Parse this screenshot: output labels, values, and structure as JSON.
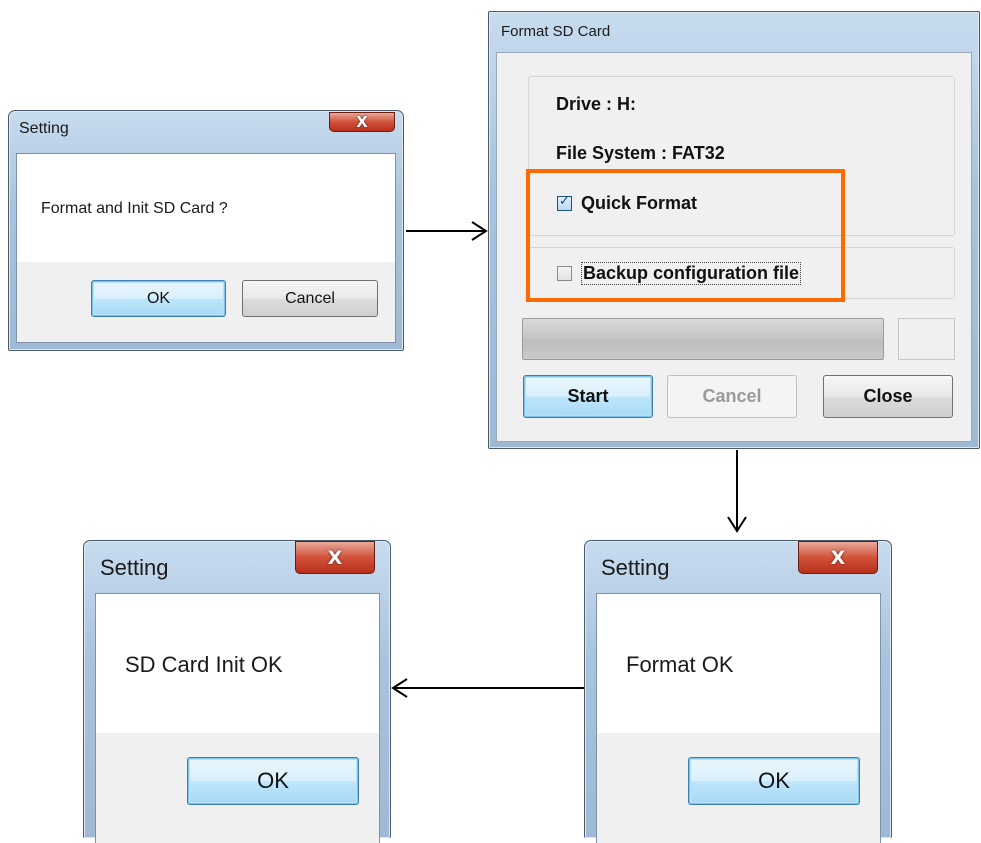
{
  "dialog_confirm": {
    "title": "Setting",
    "message": "Format and Init SD Card ?",
    "ok_label": "OK",
    "cancel_label": "Cancel",
    "close_glyph": "X"
  },
  "dialog_format": {
    "title": "Format SD Card",
    "drive_label": "Drive : H:",
    "filesystem_label": "File System : FAT32",
    "quick_format_label": "Quick Format",
    "quick_format_checked": true,
    "backup_label": "Backup configuration file",
    "backup_checked": false,
    "start_label": "Start",
    "cancel_label": "Cancel",
    "close_label": "Close",
    "highlight_color": "#ff6a00"
  },
  "dialog_format_ok": {
    "title": "Setting",
    "message": "Format OK",
    "ok_label": "OK",
    "close_glyph": "X"
  },
  "dialog_init_ok": {
    "title": "Setting",
    "message": "SD Card Init OK",
    "ok_label": "OK",
    "close_glyph": "X"
  }
}
